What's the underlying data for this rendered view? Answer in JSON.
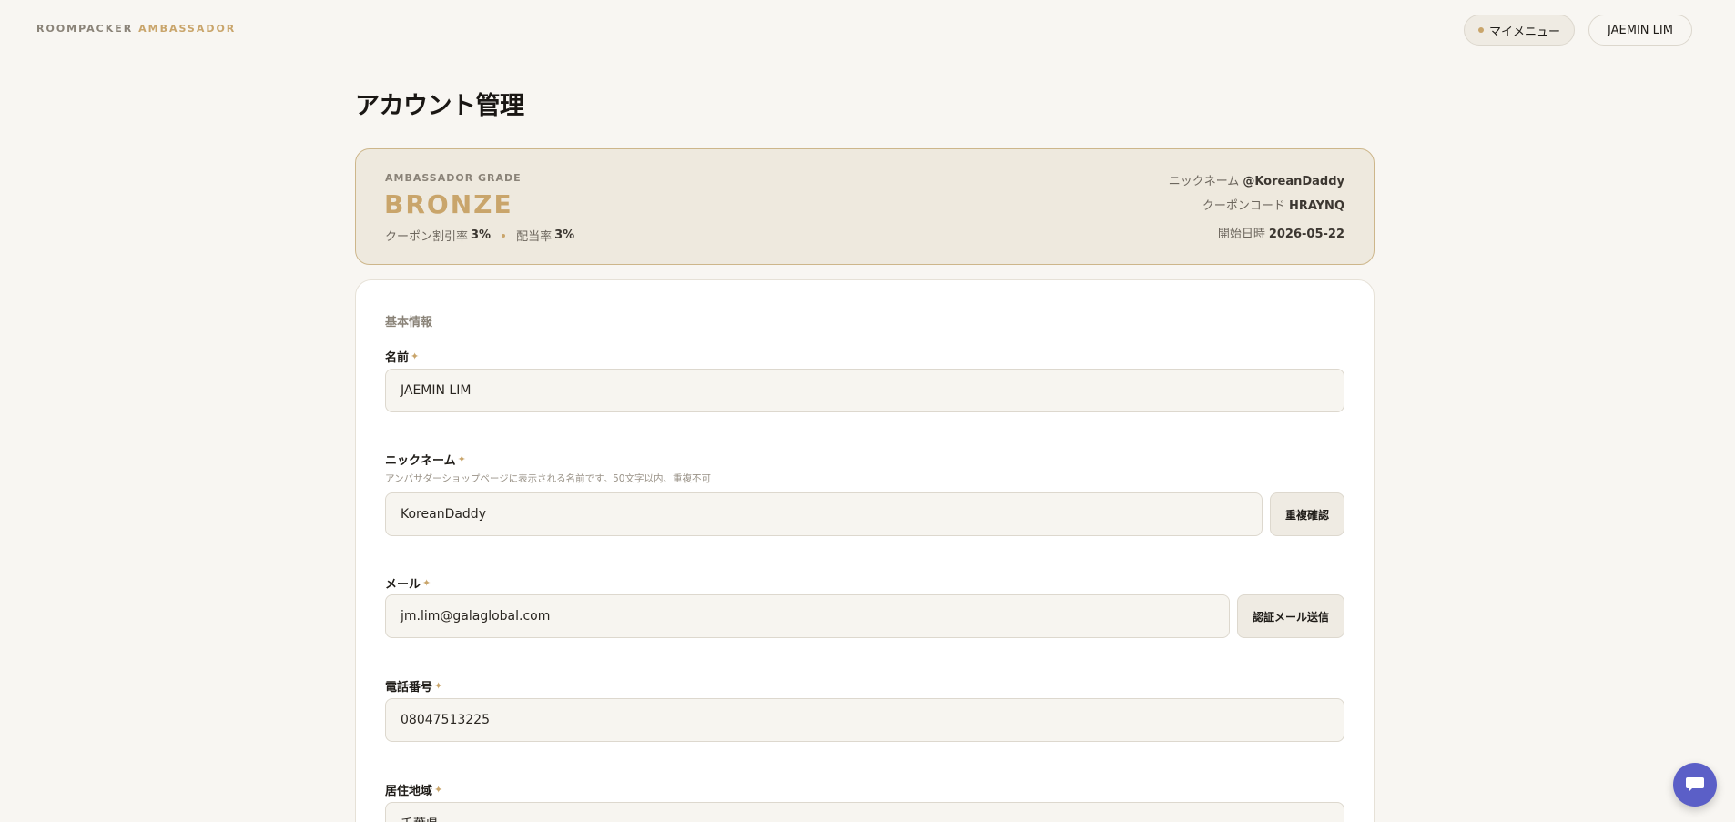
{
  "header": {
    "brand_primary": "ROOMPACKER",
    "brand_accent": "AMBASSADOR",
    "menu_label": "マイメニュー",
    "user_label": "JAEMIN LIM"
  },
  "page": {
    "title": "アカウント管理"
  },
  "grade": {
    "label": "AMBASSADOR GRADE",
    "value": "BRONZE",
    "coupon_rate_label": "クーポン割引率",
    "coupon_rate_value": "3%",
    "dividend_label": "配当率",
    "dividend_value": "3%",
    "nickname_label": "ニックネーム",
    "nickname_value": "@KoreanDaddy",
    "coupon_code_label": "クーポンコード",
    "coupon_code_value": "HRAYNQ",
    "start_label": "開始日時",
    "start_value": "2026-05-22"
  },
  "form": {
    "section_title": "基本情報",
    "required_mark": "✦",
    "name": {
      "label": "名前",
      "value": "JAEMIN LIM"
    },
    "nickname": {
      "label": "ニックネーム",
      "hint": "アンバサダーショップページに表示される名前です。50文字以内、重複不可",
      "value": "KoreanDaddy",
      "button": "重複確認"
    },
    "email": {
      "label": "メール",
      "value": "jm.lim@galaglobal.com",
      "button": "認証メール送信"
    },
    "phone": {
      "label": "電話番号",
      "value": "08047513225"
    },
    "region": {
      "label": "居住地域",
      "value": "千葉県"
    }
  },
  "colors": {
    "accent": "#c9a56b",
    "background": "#f8f6f2",
    "chat": "#5b5fc7"
  },
  "icons": {
    "chat": "chat-bubble-icon",
    "chevron": "chevron-down-icon",
    "menu_dot": "status-dot-icon"
  }
}
